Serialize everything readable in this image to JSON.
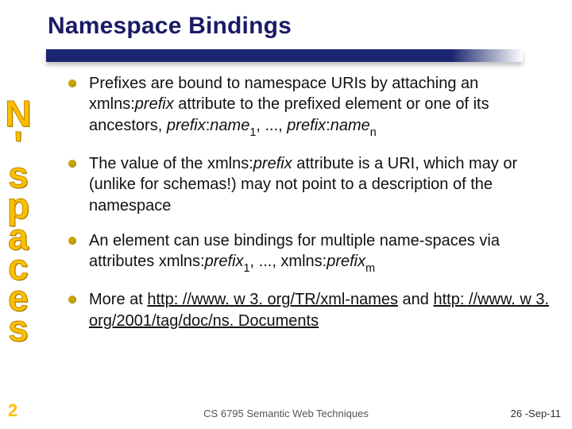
{
  "title": "Namespace Bindings",
  "sideLabel": "N'spaces",
  "bullets": [
    {
      "p1": "Prefixes are bound to namespace URIs by attaching an xmlns:",
      "i1": "prefix",
      "p2": " attribute to the prefixed element or one of its ancestors, ",
      "i2": "prefix",
      "p3": ":",
      "i3": "name",
      "sub1": "1",
      "p4": ", ..., ",
      "i4": "prefix",
      "p5": ":",
      "i5": "name",
      "sub2": "n"
    },
    {
      "p1": "The value of the xmlns:",
      "i1": "prefix",
      "p2": " attribute is a URI, which may or (unlike for schemas!) may not point to a description of the namespace"
    },
    {
      "p1": "An element can use bindings for multiple name-spaces via attributes xmlns:",
      "i1": "prefix",
      "sub1": "1",
      "p2": ", ..., xmlns:",
      "i2": "prefix",
      "sub2": "m"
    },
    {
      "p1": "More at ",
      "u1": "http: //www. w 3. org/TR/xml-names",
      "p2": " and ",
      "u2": "http: //www. w 3. org/2001/tag/doc/ns. Documents"
    }
  ],
  "slideNumber": "2",
  "footerCourse": "CS 6795 Semantic Web Techniques",
  "footerDate": "26 -Sep-11"
}
